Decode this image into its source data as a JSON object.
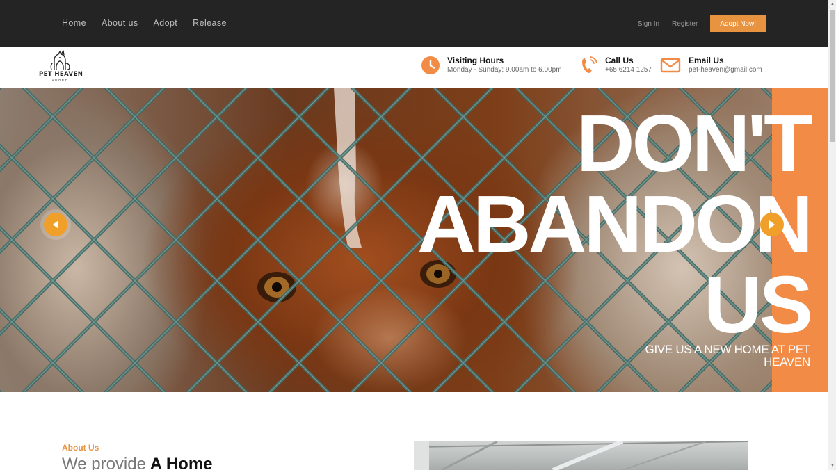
{
  "nav": {
    "links": [
      "Home",
      "About us",
      "Adopt",
      "Release"
    ],
    "sign_in": "Sign In",
    "register": "Register",
    "adopt_now": "Adopt Now!"
  },
  "brand": {
    "name": "PET HEAVEN",
    "tagline": "ADOPT"
  },
  "info": {
    "hours": {
      "title": "Visiting Hours",
      "text": "Monday - Sunday: 9.00am to 6.00pm",
      "icon": "clock-icon"
    },
    "call": {
      "title": "Call Us",
      "text": "+65 6214 1257",
      "icon": "phone-icon"
    },
    "email": {
      "title": "Email Us",
      "text": "pet-heaven@gmail.com",
      "icon": "envelope-icon"
    }
  },
  "hero": {
    "headline": [
      "DON'T",
      "ABANDON",
      "US"
    ],
    "subheadline": "GIVE US A NEW HOME AT PET HEAVEN",
    "prev_icon": "arrow-left-icon",
    "next_icon": "arrow-right-icon"
  },
  "about": {
    "tag": "About Us",
    "title_light": "We provide",
    "title_strong": "A Home"
  },
  "colors": {
    "accent": "#e8933f",
    "topbar": "#242424",
    "hero_panel": "#f28b45"
  }
}
